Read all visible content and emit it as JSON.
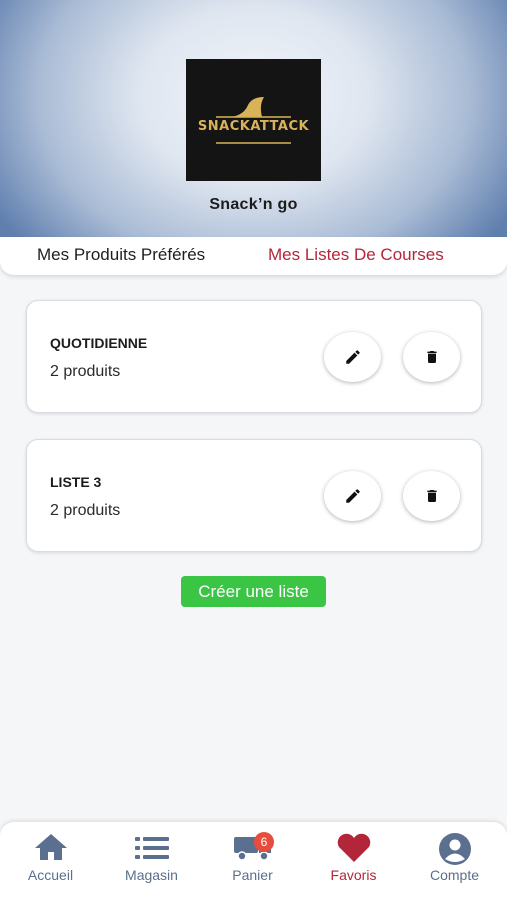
{
  "header": {
    "logo_text": "SNACKATTACK",
    "store_name": "Snack’n go"
  },
  "tabs": [
    {
      "label": "Mes Produits Préférés",
      "active": false
    },
    {
      "label": "Mes Listes De Courses",
      "active": true
    }
  ],
  "lists": [
    {
      "title": "QUOTIDIENNE",
      "count": "2 produits"
    },
    {
      "title": "LISTE 3",
      "count": "2 produits"
    }
  ],
  "create_button": {
    "label": "Créer une liste"
  },
  "bottom_nav": {
    "items": [
      {
        "label": "Accueil",
        "icon": "home-icon"
      },
      {
        "label": "Magasin",
        "icon": "list-icon"
      },
      {
        "label": "Panier",
        "icon": "truck-icon",
        "badge": "6"
      },
      {
        "label": "Favoris",
        "icon": "heart-icon",
        "active": true
      },
      {
        "label": "Compte",
        "icon": "account-icon"
      }
    ]
  },
  "colors": {
    "accent": "#b3263a",
    "create_button": "#3ac644",
    "nav_icon": "#5b6f8e",
    "badge": "#e64d3d",
    "logo_gold": "#d8b35a"
  }
}
